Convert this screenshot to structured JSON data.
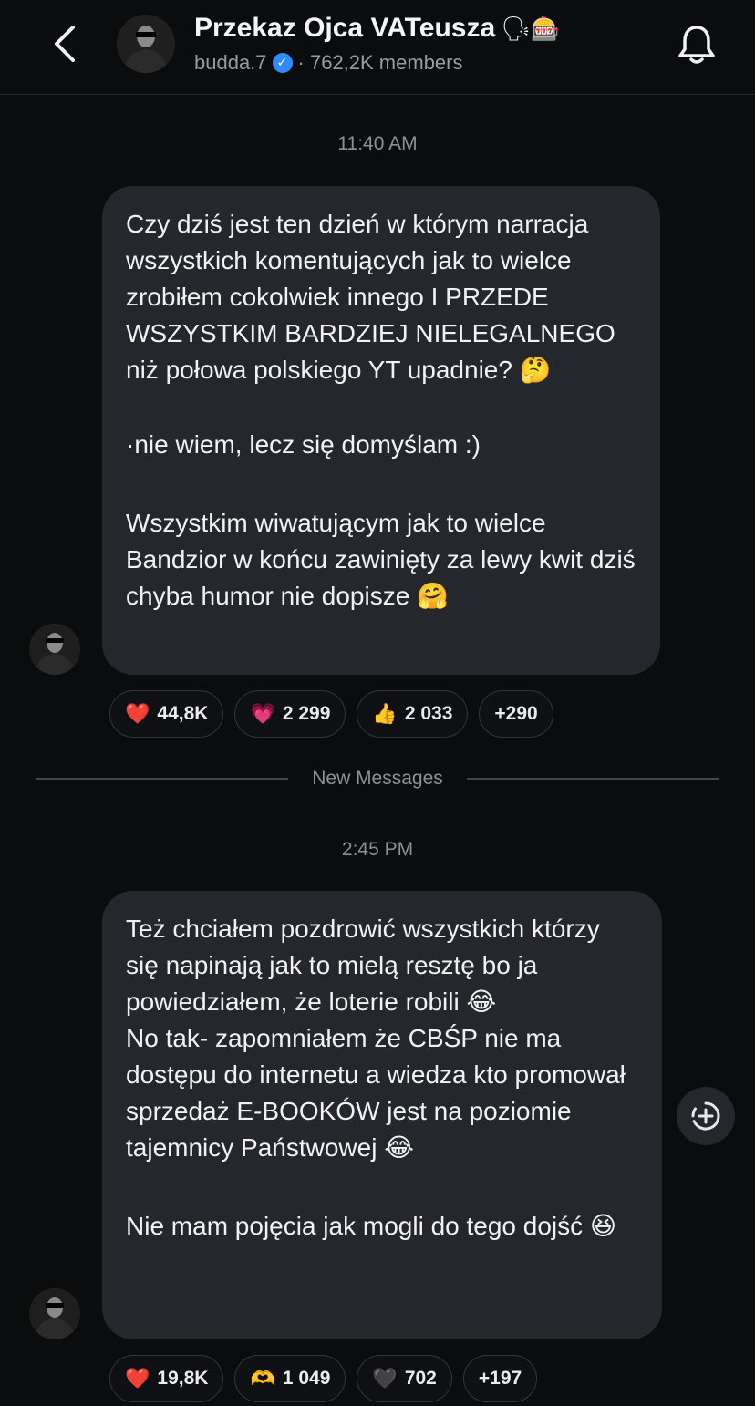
{
  "header": {
    "back_icon": "chevron-left-icon",
    "title": "Przekaz Ojca VATeusza",
    "title_emoji": "🗣🎰",
    "username": "budda.7",
    "verified_icon": "verified-badge-icon",
    "members": "· 762,2K members",
    "bell_icon": "bell-icon"
  },
  "messages": [
    {
      "time": "11:40 AM",
      "paragraphs": [
        "Czy dziś jest ten dzień w którym narracja wszystkich komentujących jak to wielce zrobiłem cokolwiek innego I PRZEDE WSZYSTKIM BARDZIEJ NIELEGALNEGO niż połowa polskiego YT upadnie? 🤔",
        "·nie wiem, lecz się domyślam :)",
        "Wszystkim wiwatującym jak to wielce Bandzior w końcu zawinięty za lewy kwit dziś chyba humor nie dopisze 🤗"
      ],
      "reactions": [
        {
          "emoji": "❤️",
          "count": "44,8K"
        },
        {
          "emoji": "💗",
          "count": "2 299"
        },
        {
          "emoji": "👍",
          "count": "2 033"
        },
        {
          "emoji": "",
          "count": "+290"
        }
      ]
    },
    {
      "time": "2:45 PM",
      "paragraphs": [
        "Też chciałem pozdrowić wszystkich którzy się napinają jak to mielą resztę bo ja powiedziałem, że loterie robili 😂\nNo tak- zapomniałem że CBŚP nie ma dostępu do internetu a wiedza kto promował sprzedaż E-BOOKÓW jest na poziomie tajemnicy Państwowej 😂",
        "Nie mam pojęcia jak mogli do tego dojść 😆"
      ],
      "reactions": [
        {
          "emoji": "❤️",
          "count": "19,8K"
        },
        {
          "emoji": "🫶",
          "count": "1 049"
        },
        {
          "emoji": "🖤",
          "count": "702"
        },
        {
          "emoji": "",
          "count": "+197"
        }
      ]
    }
  ],
  "divider": {
    "label": "New Messages"
  },
  "react_button_icon": "add-reaction-icon",
  "colors": {
    "background": "#0b0c0e",
    "bubble": "#26272d",
    "verified": "#2f8cff",
    "muted_text": "#8e8f96"
  }
}
